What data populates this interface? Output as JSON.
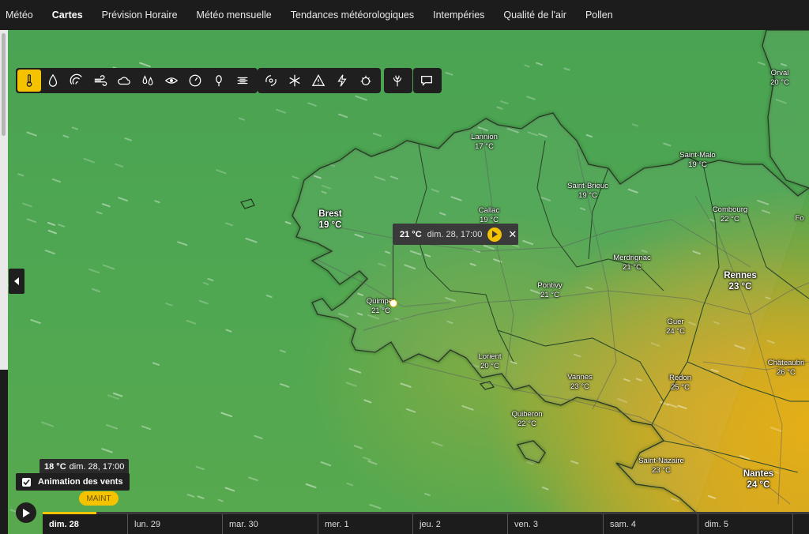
{
  "nav": {
    "items": [
      "Météo",
      "Cartes",
      "Prévision Horaire",
      "Météo mensuelle",
      "Tendances météorologiques",
      "Intempéries",
      "Qualité de l'air",
      "Pollen"
    ],
    "active": "Cartes"
  },
  "toolbar": {
    "layers": [
      "thermometer-icon",
      "droplet-icon",
      "wind-gust-icon",
      "wind-icon",
      "cloud-icon",
      "rain-drops-icon",
      "eye-icon",
      "pressure-gauge-icon",
      "tree-icon",
      "fog-icon"
    ],
    "alerts": [
      "hurricane-icon",
      "snowflake-icon",
      "warning-icon",
      "lightning-icon",
      "virus-icon"
    ],
    "extra": [
      "plant-icon"
    ],
    "feedback": [
      "chat-icon"
    ],
    "active_layer": "thermometer-icon",
    "accent": "#f5c200"
  },
  "cities": [
    {
      "name": "Lannion",
      "temp": "17 °C"
    },
    {
      "name": "Saint-Malo",
      "temp": "19 °C"
    },
    {
      "name": "Orval",
      "temp": "20 °C"
    },
    {
      "name": "Saint-Brieuc",
      "temp": "19 °C"
    },
    {
      "name": "Brest",
      "temp": "19 °C"
    },
    {
      "name": "Callac",
      "temp": "19 °C"
    },
    {
      "name": "Combourg",
      "temp": "22 °C"
    },
    {
      "name": "Merdrignac",
      "temp": "21 °C"
    },
    {
      "name": "Rennes",
      "temp": "23 °C"
    },
    {
      "name": "Pontivy",
      "temp": "21 °C"
    },
    {
      "name": "Quimper",
      "temp": "21 °C"
    },
    {
      "name": "Guer",
      "temp": "24 °C"
    },
    {
      "name": "Lorient",
      "temp": "20 °C"
    },
    {
      "name": "Châteaubri",
      "temp": "26 °C"
    },
    {
      "name": "Vannes",
      "temp": "23 °C"
    },
    {
      "name": "Redon",
      "temp": "25 °C"
    },
    {
      "name": "Quiberon",
      "temp": "22 °C"
    },
    {
      "name": "Saint-Nazaire",
      "temp": "23 °C"
    },
    {
      "name": "Nantes",
      "temp": "24 °C"
    },
    {
      "name": "Fo",
      "temp": ""
    }
  ],
  "popup": {
    "temp": "21 °C",
    "datetime": "dim. 28, 17:00"
  },
  "hover": {
    "temp": "18 °C",
    "datetime": "dim. 28, 17:00"
  },
  "wind": {
    "label": "Animation des vents",
    "checked": true
  },
  "now_badge": "MAINT",
  "timeline": {
    "days": [
      "dim. 28",
      "lun. 29",
      "mar. 30",
      "mer. 1",
      "jeu. 2",
      "ven. 3",
      "sam. 4",
      "dim. 5",
      ""
    ],
    "progress": 0.07
  }
}
